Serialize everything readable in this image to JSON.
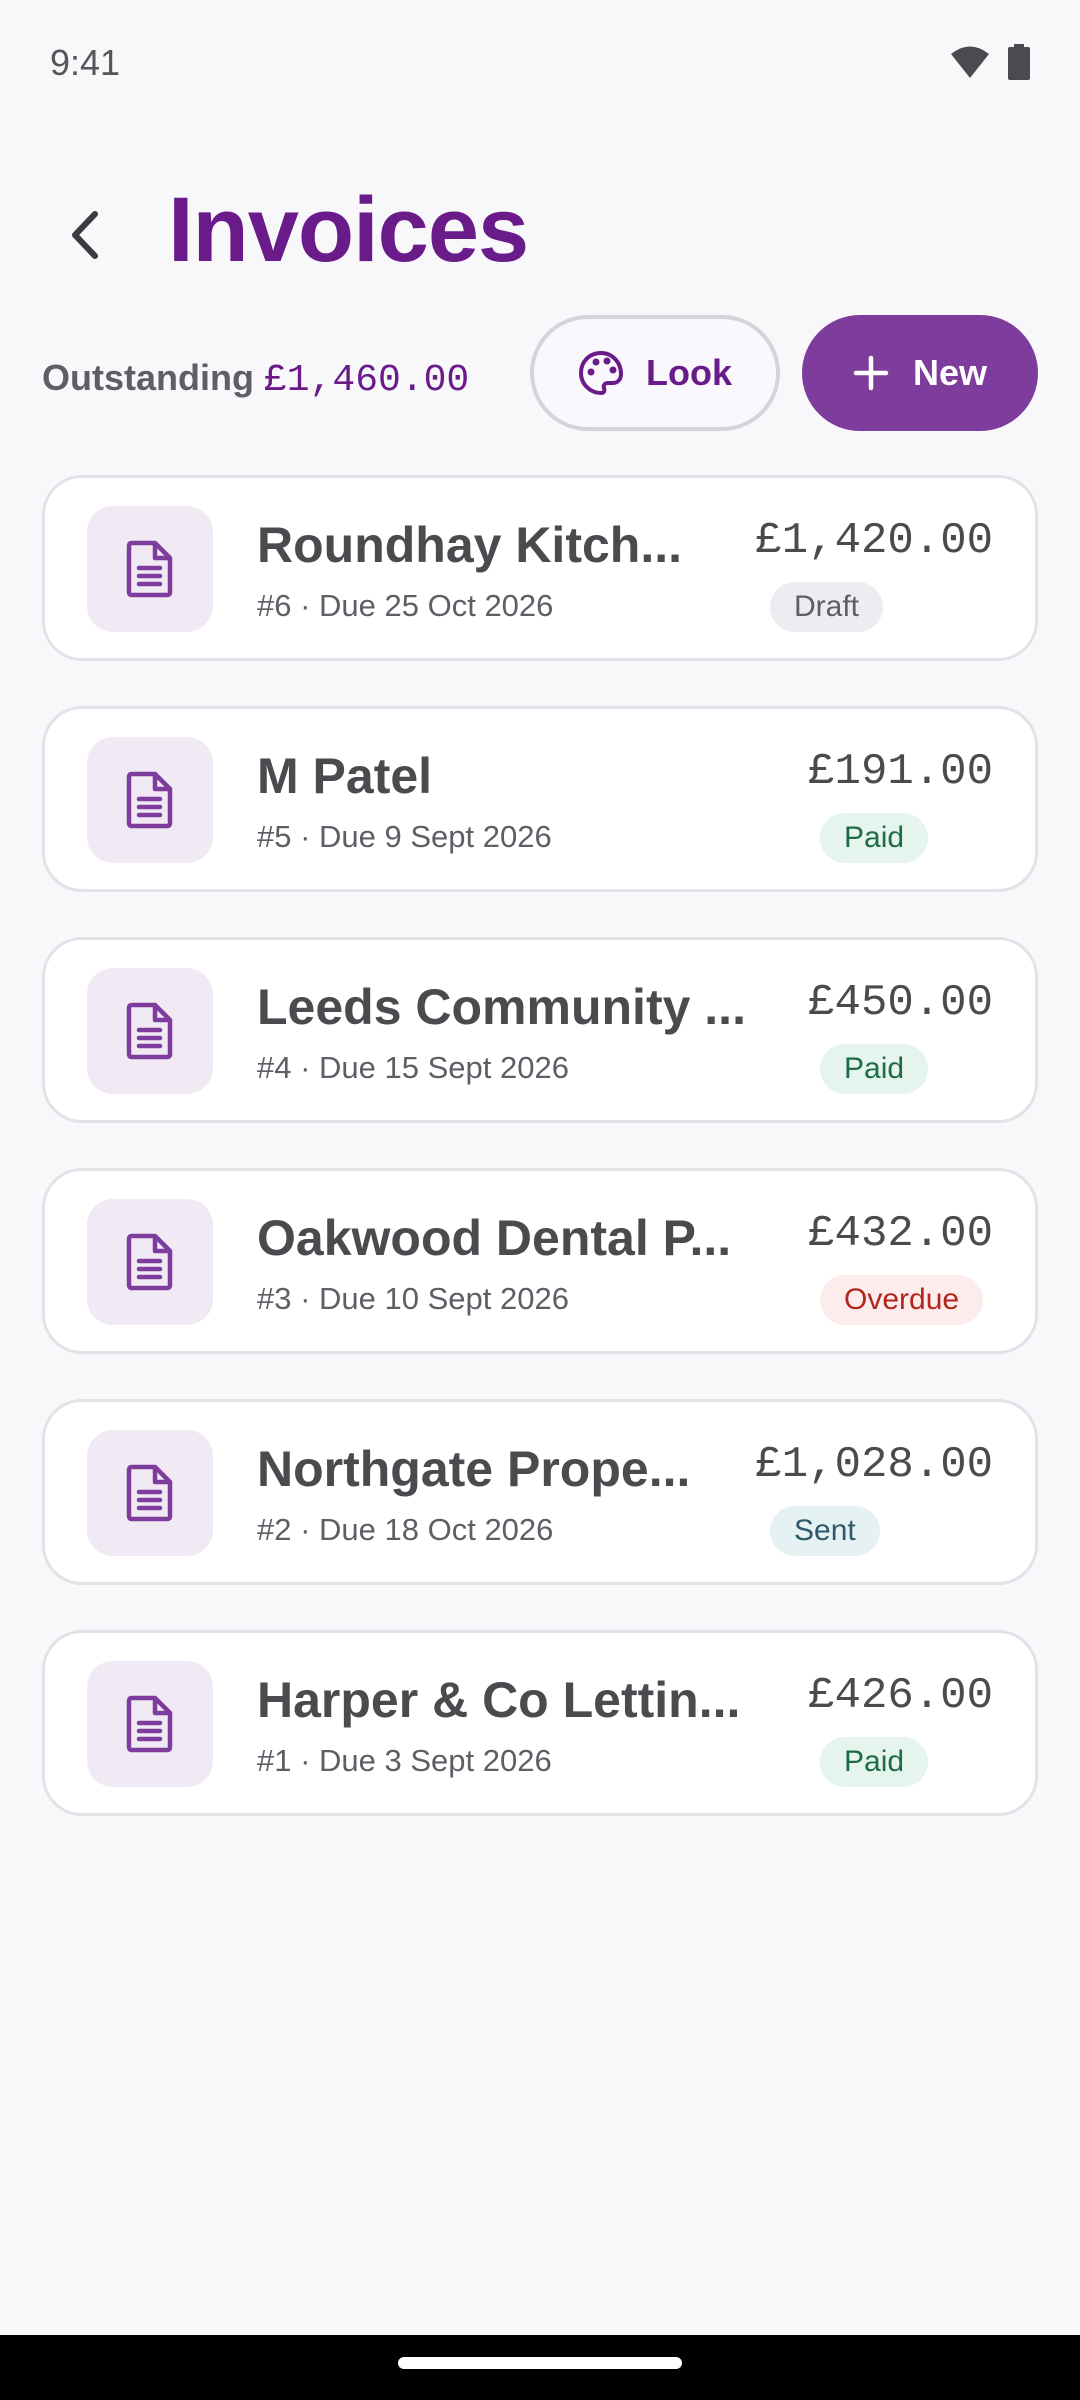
{
  "status": {
    "time": "9:41"
  },
  "header": {
    "title": "Invoices"
  },
  "summary": {
    "label": "Outstanding",
    "amount": "£1,460.00",
    "look_label": "Look",
    "new_label": "New"
  },
  "invoices": [
    {
      "client": "Roundhay Kitch...",
      "meta": "#6 · Due 25 Oct 2026",
      "amount": "£1,420.00",
      "status": "Draft"
    },
    {
      "client": "M Patel",
      "meta": "#5 · Due 9 Sept 2026",
      "amount": "£191.00",
      "status": "Paid"
    },
    {
      "client": "Leeds Community ...",
      "meta": "#4 · Due 15 Sept 2026",
      "amount": "£450.00",
      "status": "Paid"
    },
    {
      "client": "Oakwood Dental P...",
      "meta": "#3 · Due 10 Sept 2026",
      "amount": "£432.00",
      "status": "Overdue"
    },
    {
      "client": "Northgate Prope...",
      "meta": "#2 · Due 18 Oct 2026",
      "amount": "£1,028.00",
      "status": "Sent"
    },
    {
      "client": "Harper & Co Lettin...",
      "meta": "#1 · Due 3 Sept 2026",
      "amount": "£426.00",
      "status": "Paid"
    }
  ],
  "colors": {
    "accent": "#6A1B8A",
    "button": "#7E3C9C",
    "draft_bg": "#EDECF0",
    "draft_fg": "#5E5E66",
    "paid_bg": "#E6F4EE",
    "paid_fg": "#1E6B4A",
    "overdue_bg": "#FDECEC",
    "overdue_fg": "#B3261E",
    "sent_bg": "#E6F1F4",
    "sent_fg": "#2E5A6B"
  },
  "icons": [
    "back-arrow-icon",
    "palette-icon",
    "plus-icon",
    "document-icon",
    "wifi-icon",
    "battery-icon"
  ]
}
